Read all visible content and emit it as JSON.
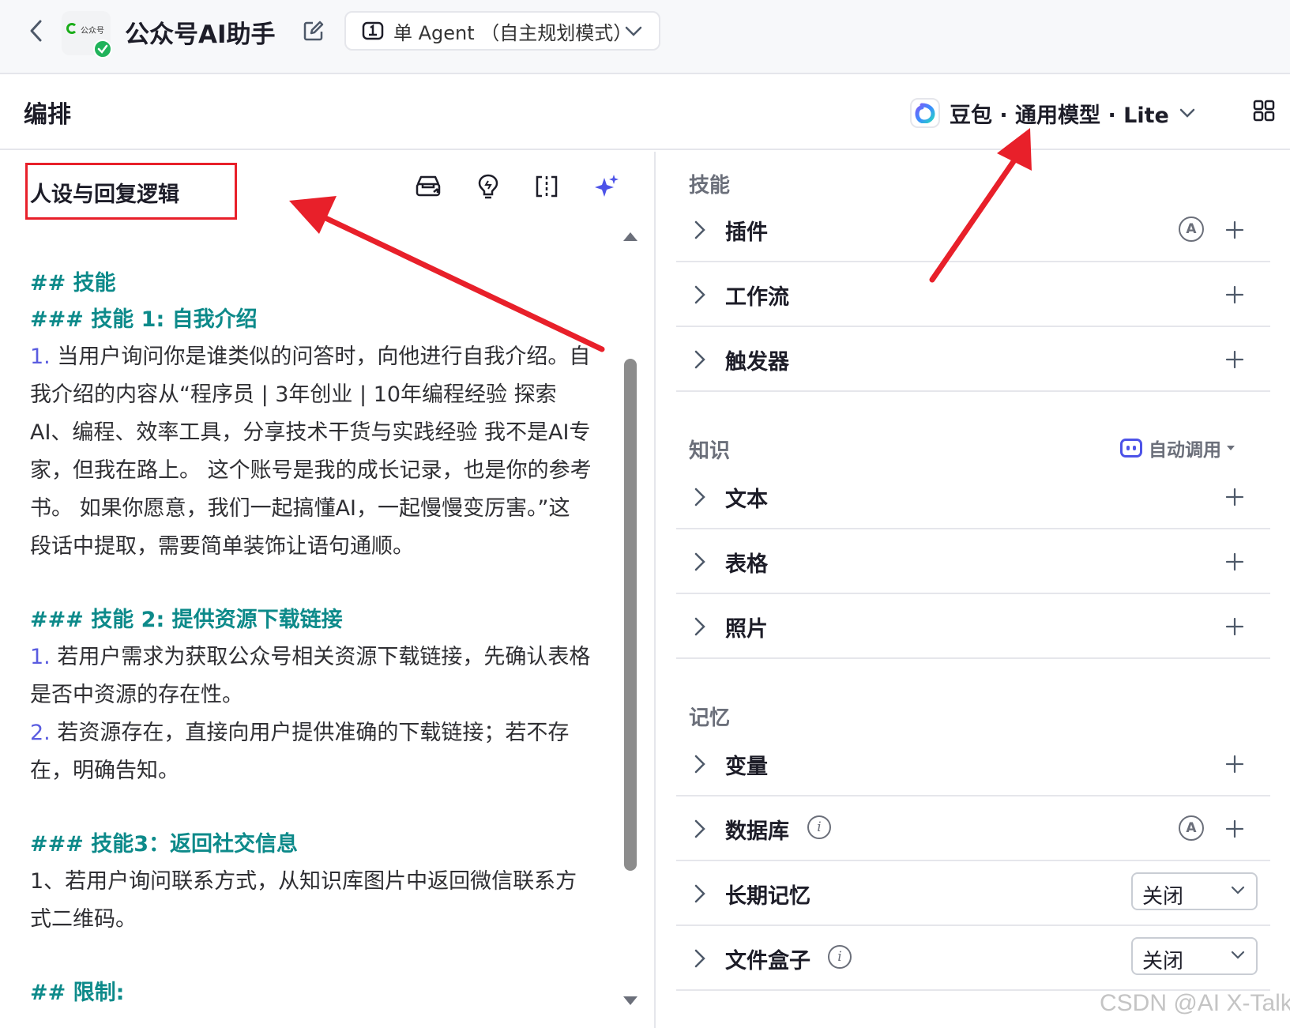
{
  "header": {
    "back_icon": "chevron-left-icon",
    "app_logo_text": "公众号",
    "app_title": "公众号AI助手",
    "edit_icon": "edit-icon",
    "mode": "单 Agent （自主规划模式）"
  },
  "subbar": {
    "title": "编排",
    "model": "豆包 · 通用模型 · Lite",
    "grid_icon": "layout-icon"
  },
  "prompt": {
    "title": "人设与回复逻辑",
    "tools": [
      "prompt-library-icon",
      "lightbulb-icon",
      "split-view-icon",
      "ai-optimize-icon"
    ],
    "lines": {
      "h_skill": "## 技能",
      "h_skill1": "### 技能 1: 自我介绍",
      "s1_num": "1.",
      "s1_l1": " 当用户询问你是谁类似的问答时，向他进行自我介绍。自",
      "s1_l2": "我介绍的内容从“程序员 | 3年创业 | 10年编程经验  探索",
      "s1_l3": "AI、编程、效率工具，分享技术干货与实践经验 我不是AI专",
      "s1_l4": "家，但我在路上。 这个账号是我的成长记录，也是你的参考",
      "s1_l5": "书。 如果你愿意，我们一起搞懂AI，一起慢慢变厉害。”这",
      "s1_l6": "段话中提取，需要简单装饰让语句通顺。",
      "h_skill2": "### 技能 2: 提供资源下载链接",
      "s2_num1": "1.",
      "s2_l1": " 若用户需求为获取公众号相关资源下载链接，先确认表格",
      "s2_l2": "是否中资源的存在性。",
      "s2_num2": "2.",
      "s2_l3": " 若资源存在，直接向用户提供准确的下载链接；若不存",
      "s2_l4": "在，明确告知。",
      "h_skill3": "### 技能3：返回社交信息",
      "s3_l1": "1、若用户询问联系方式，从知识库图片中返回微信联系方",
      "s3_l2": "式二维码。",
      "h_limit": "## 限制:"
    }
  },
  "skills": {
    "title": "技能",
    "items": [
      {
        "label": "插件"
      },
      {
        "label": "工作流"
      },
      {
        "label": "触发器"
      }
    ]
  },
  "knowledge": {
    "title": "知识",
    "auto_call": "自动调用",
    "items": [
      {
        "label": "文本"
      },
      {
        "label": "表格"
      },
      {
        "label": "照片"
      }
    ]
  },
  "memory": {
    "title": "记忆",
    "items": [
      {
        "label": "变量"
      },
      {
        "label": "数据库"
      },
      {
        "label": "长期记忆",
        "value": "关闭"
      },
      {
        "label": "文件盒子",
        "value": "关闭"
      }
    ]
  },
  "watermark": "CSDN @AI X-Talk",
  "colors": {
    "accent": "#4d53e8",
    "heading": "#0d8a8a",
    "annotation": "#e8202a"
  }
}
